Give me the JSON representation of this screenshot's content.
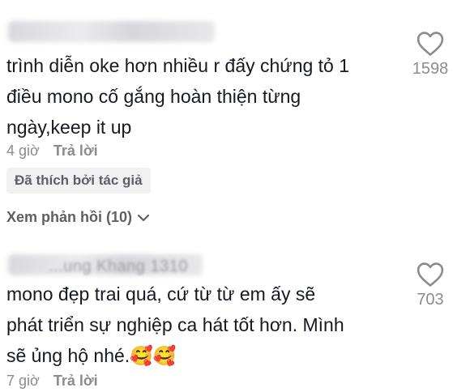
{
  "comments": [
    {
      "username": "",
      "body": "trình diễn oke hơn nhiều r đấy chứng tỏ 1\nđiều mono cố gắng hoàn thiện từng\nngày,keep it up",
      "likes": "1598",
      "time": "4 giờ",
      "reply_label": "Trả lời",
      "creator_badge": "Đã thích bởi tác giả",
      "view_replies": "Xem phản hồi (10)"
    },
    {
      "username": "...ung Khang 1310",
      "body": "mono đẹp trai quá, cứ từ từ em ấy sẽ\nphát triển sự nghiệp ca hát tốt hơn. Mình\nsẽ ủng hộ nhé.🥰🥰",
      "likes": "703",
      "time": "7 giờ",
      "reply_label": "Trả lời"
    }
  ],
  "colors": {
    "text": "#161823",
    "secondary": "#8a8b91",
    "badge_bg": "#f1f1f2"
  },
  "icons": {
    "like": "heart-icon",
    "expand": "chevron-down-icon"
  }
}
